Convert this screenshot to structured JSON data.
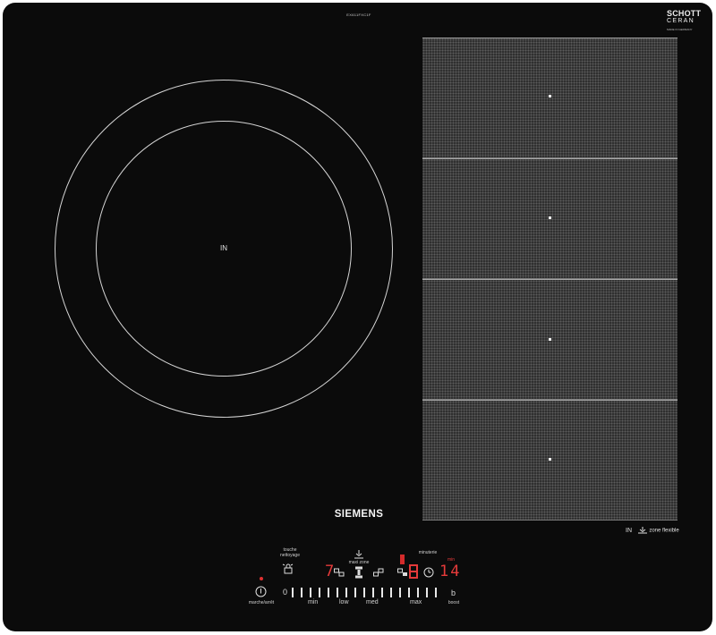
{
  "model_code": "EX611FXC1F",
  "glass_brand": {
    "line1": "SCHOTT",
    "line2": "CERAN",
    "line3": "MADE IN GERMANY"
  },
  "zones": {
    "round_zone_label": "IN",
    "flex_zone_count": 4
  },
  "flex_legend": {
    "in_label": "IN",
    "zone_label": "zone flexible"
  },
  "brand": "SIEMENS",
  "controls": {
    "cleaning_label": "touche\nnettoyage",
    "maxi_zone_label": "maxi zone",
    "timer_label": "minuterie",
    "timer_unit": "min",
    "power_label": "marche/arrêt",
    "boost_label": "boost",
    "boost_letter": "b",
    "zero_label": "0",
    "level_display": "7",
    "timer_display": "14",
    "scale": {
      "min": "min",
      "low": "low",
      "med": "med",
      "max": "max"
    }
  },
  "colors": {
    "glass": "#0b0b0b",
    "led_red": "#e53a3a"
  }
}
